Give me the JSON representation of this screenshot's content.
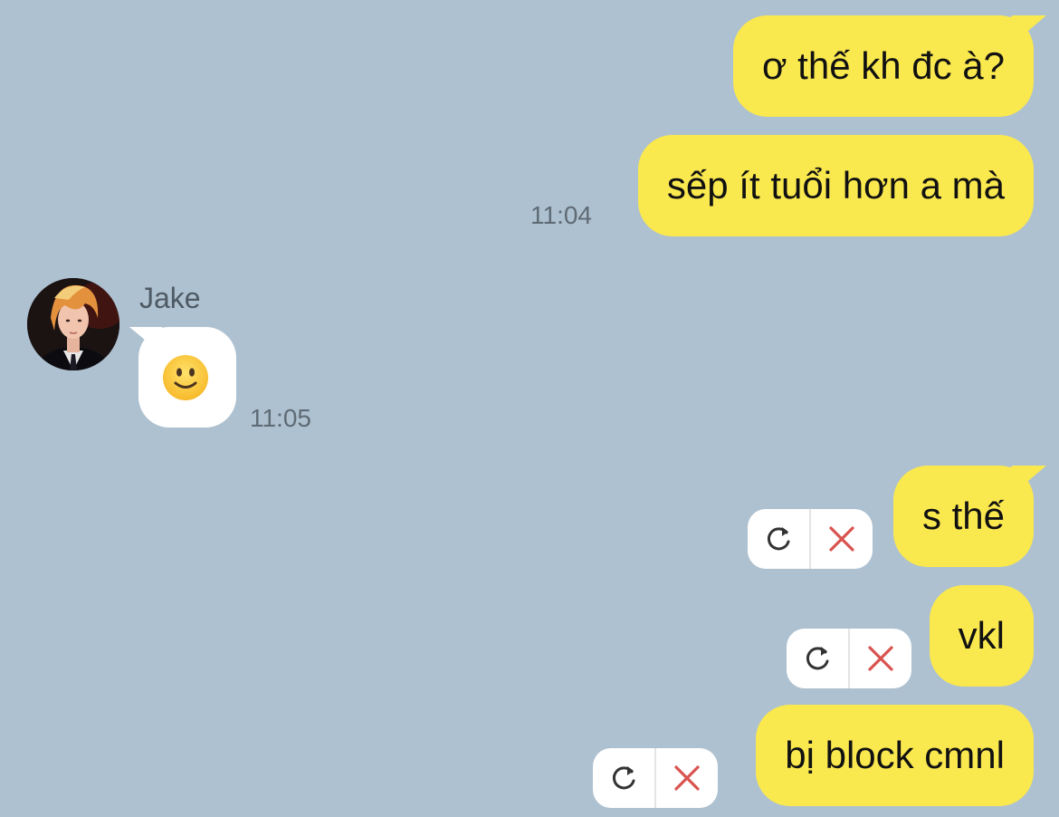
{
  "conversation": {
    "outgoing_top": [
      {
        "text": "ơ thế kh đc à?"
      },
      {
        "text": "sếp ít tuổi hơn a mà",
        "time": "11:04"
      }
    ],
    "incoming": {
      "sender": "Jake",
      "message_icon": "slightly-smiling-face-emoji",
      "time": "11:05",
      "avatar": "profile-photo"
    },
    "outgoing_failed": [
      {
        "text": "s thế"
      },
      {
        "text": "vkl"
      },
      {
        "text": "bị block cmnl"
      }
    ]
  },
  "icons": {
    "retry": "refresh-icon",
    "cancel": "close-icon"
  },
  "colors": {
    "background": "#aec1d0",
    "outgoing_bubble": "#fae84f",
    "incoming_bubble": "#ffffff",
    "timestamp": "#5f6b75",
    "cancel_icon": "#d9534f",
    "retry_icon": "#333333"
  }
}
